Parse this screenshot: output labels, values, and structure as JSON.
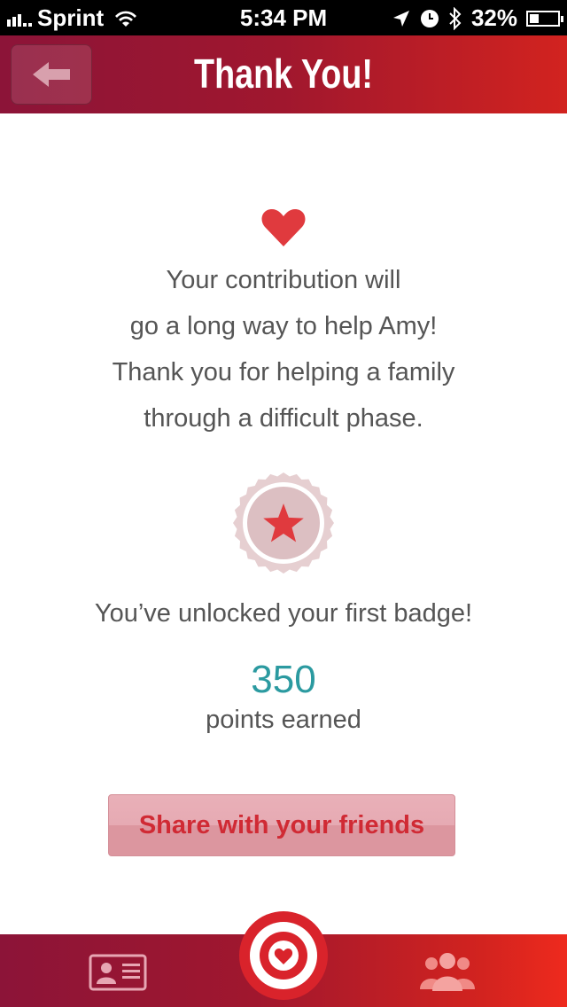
{
  "status_bar": {
    "carrier": "Sprint",
    "time": "5:34 PM",
    "battery": "32%",
    "battery_level": 0.32
  },
  "nav": {
    "title": "Thank You!",
    "back_icon": "back-arrow-icon"
  },
  "main": {
    "message_lines": [
      "Your contribution will",
      "go a long way to help Amy!",
      "Thank you for helping a family",
      "through a difficult phase."
    ],
    "badge_text": "You’ve unlocked your first badge!",
    "points_value": "350",
    "points_label": "points earned",
    "share_label": "Share with your friends"
  },
  "tab_bar": {
    "items": [
      {
        "icon": "profile-card-icon"
      },
      {
        "icon": "target-heart-icon"
      },
      {
        "icon": "community-icon"
      }
    ]
  },
  "colors": {
    "nav_start": "#8c1438",
    "nav_end": "#d2231f",
    "accent_red": "#e03a3e",
    "points_teal": "#2b9aa0",
    "share_text": "#d02a34"
  }
}
